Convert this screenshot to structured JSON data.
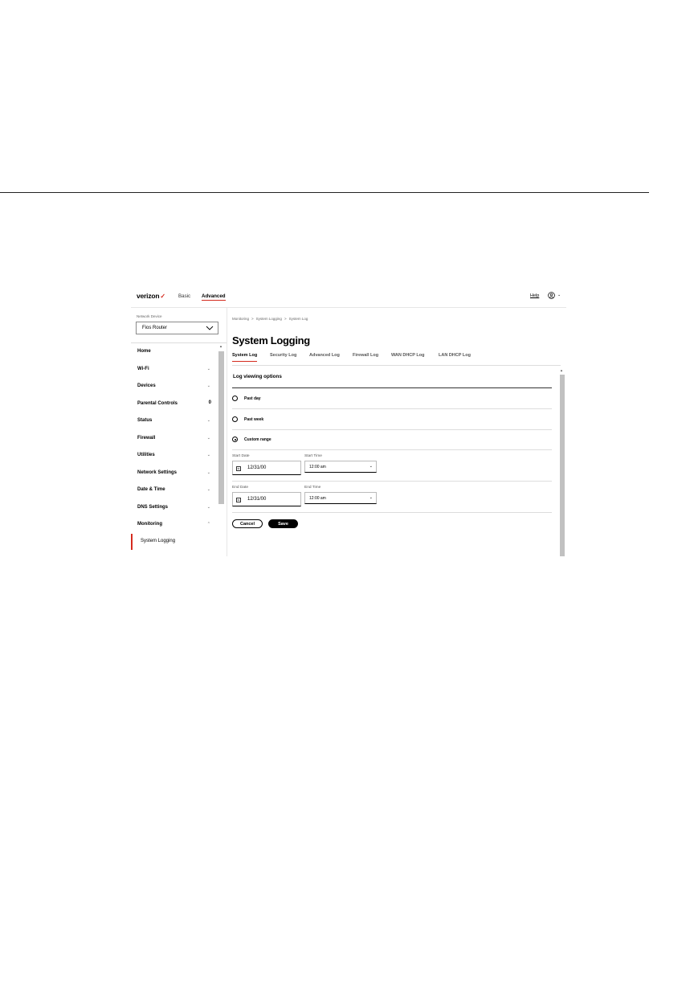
{
  "nav": {
    "logo": "verizon",
    "logo_mark": "✓",
    "tabs": [
      {
        "label": "Basic",
        "active": false
      },
      {
        "label": "Advanced",
        "active": true
      }
    ],
    "help": "Help"
  },
  "sidebar": {
    "network_device_label": "Network Device",
    "network_device_value": "Fios Router",
    "items": [
      {
        "label": "Home",
        "chevron": ""
      },
      {
        "label": "Wi-Fi",
        "chevron": "⌄"
      },
      {
        "label": "Devices",
        "chevron": "⌄"
      },
      {
        "label": "Parental Controls",
        "badge": "0"
      },
      {
        "label": "Status",
        "chevron": "⌄"
      },
      {
        "label": "Firewall",
        "chevron": "⌄"
      },
      {
        "label": "Utilities",
        "chevron": "⌄"
      },
      {
        "label": "Network Settings",
        "chevron": "⌄"
      },
      {
        "label": "Date & Time",
        "chevron": "⌄"
      },
      {
        "label": "DNS Settings",
        "chevron": "⌄"
      },
      {
        "label": "Monitoring",
        "chevron": "⌃"
      }
    ],
    "subitem": "System Logging"
  },
  "breadcrumb": [
    "Monitoring",
    ">",
    "System Logging",
    ">",
    "System Log"
  ],
  "title": "System Logging",
  "tabs": [
    {
      "label": "System Log",
      "active": true
    },
    {
      "label": "Security Log",
      "active": false
    },
    {
      "label": "Advanced Log",
      "active": false
    },
    {
      "label": "Firewall Log",
      "active": false
    },
    {
      "label": "WAN DHCP Log",
      "active": false
    },
    {
      "label": "LAN DHCP Log",
      "active": false
    }
  ],
  "options": {
    "section_title": "Log viewing options",
    "radios": [
      {
        "label": "Past day",
        "checked": false
      },
      {
        "label": "Past week",
        "checked": false
      },
      {
        "label": "Custom range",
        "checked": true
      }
    ],
    "start_date_label": "Start Date",
    "start_date_value": "12/31/00",
    "start_time_label": "Start Time",
    "start_time_value": "12:00 am",
    "end_date_label": "End Date",
    "end_date_value": "12/31/00",
    "end_time_label": "End Time",
    "end_time_value": "12:00 am",
    "calendar_icon_text": "31",
    "cancel": "Cancel",
    "save": "Save"
  }
}
